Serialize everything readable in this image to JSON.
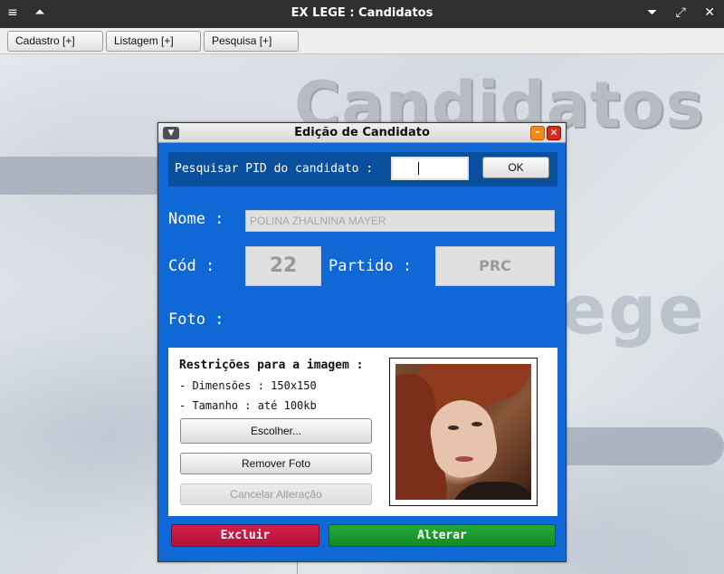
{
  "window": {
    "title": "EX LEGE : Candidatos",
    "menu_icon": "≡",
    "up_icon": "⏶",
    "min_icon": "⏷",
    "max_icon": "⤢",
    "close_icon": "✕"
  },
  "menubar": {
    "cadastro": "Cadastro [+]",
    "listagem": "Listagem [+]",
    "pesquisa": "Pesquisa [+]"
  },
  "background": {
    "heading": "Candidatos",
    "logo_text": "ege"
  },
  "dialog": {
    "title": "Edição de Candidato",
    "search": {
      "label": "Pesquisar PID do candidato :",
      "value": "",
      "ok_label": "OK"
    },
    "nome_label": "Nome :",
    "nome_value": "POLINA ZHALNINA MAYER",
    "cod_label": "Cód :",
    "cod_value": "22",
    "partido_label": "Partido :",
    "partido_value": "PRC",
    "foto_label": "Foto :",
    "restrictions": {
      "title": "Restrições para a imagem :",
      "dimensions": "- Dimensões : 150x150",
      "size": "- Tamanho : até 100kb"
    },
    "choose_label": "Escolher...",
    "remove_label": "Remover Foto",
    "cancel_label": "Cancelar Alteração",
    "delete_label": "Excluir",
    "update_label": "Alterar"
  },
  "colors": {
    "dialog_bg": "#0f68d6",
    "delete": "#c8173e",
    "update": "#1d9b30"
  }
}
